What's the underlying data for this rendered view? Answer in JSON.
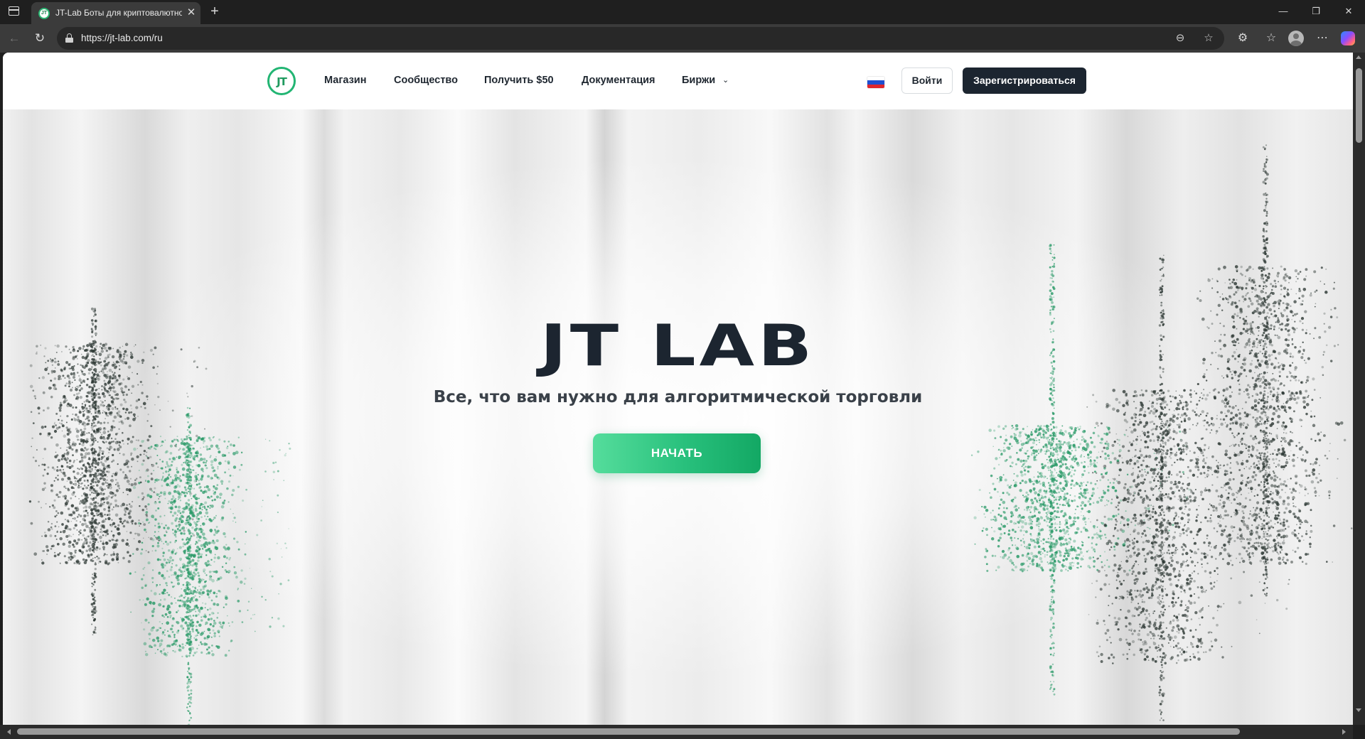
{
  "browser": {
    "tab": {
      "title": "JT-Lab Боты для криптовалютно",
      "favicon_text": "JT",
      "close_icon": "close-icon"
    },
    "new_tab_icon": "plus-icon",
    "window_controls": [
      "minimize-icon",
      "restore-icon",
      "close-icon"
    ],
    "address": {
      "url": "https://jt-lab.com/ru",
      "security_icon": "lock-icon"
    },
    "nav": {
      "back": "back-arrow-icon",
      "reload": "reload-icon"
    },
    "toolbar_icons": [
      "reader-mode-icon",
      "favorite-star-icon",
      "extensions-icon",
      "favorites-collection-icon",
      "profile-avatar",
      "more-menu-icon",
      "copilot-icon"
    ]
  },
  "site": {
    "logo_text": "JT",
    "nav": {
      "shop": "Магазин",
      "community": "Сообщество",
      "get50": "Получить $50",
      "docs": "Документация",
      "exchanges": "Биржи"
    },
    "language_flag": "ru",
    "login": "Войти",
    "register": "Зарегистрироваться"
  },
  "hero": {
    "title": "JT LAB",
    "subtitle": "Все, что вам нужно для алгоритмической торговли",
    "cta": "НАЧАТЬ"
  },
  "colors": {
    "brand_green": "#22b573",
    "cta_gradient_start": "#55dd9c",
    "cta_gradient_end": "#13a864",
    "dark": "#1c2530",
    "candle_dark": "#2f3a36",
    "candle_green": "#2a9a68"
  }
}
